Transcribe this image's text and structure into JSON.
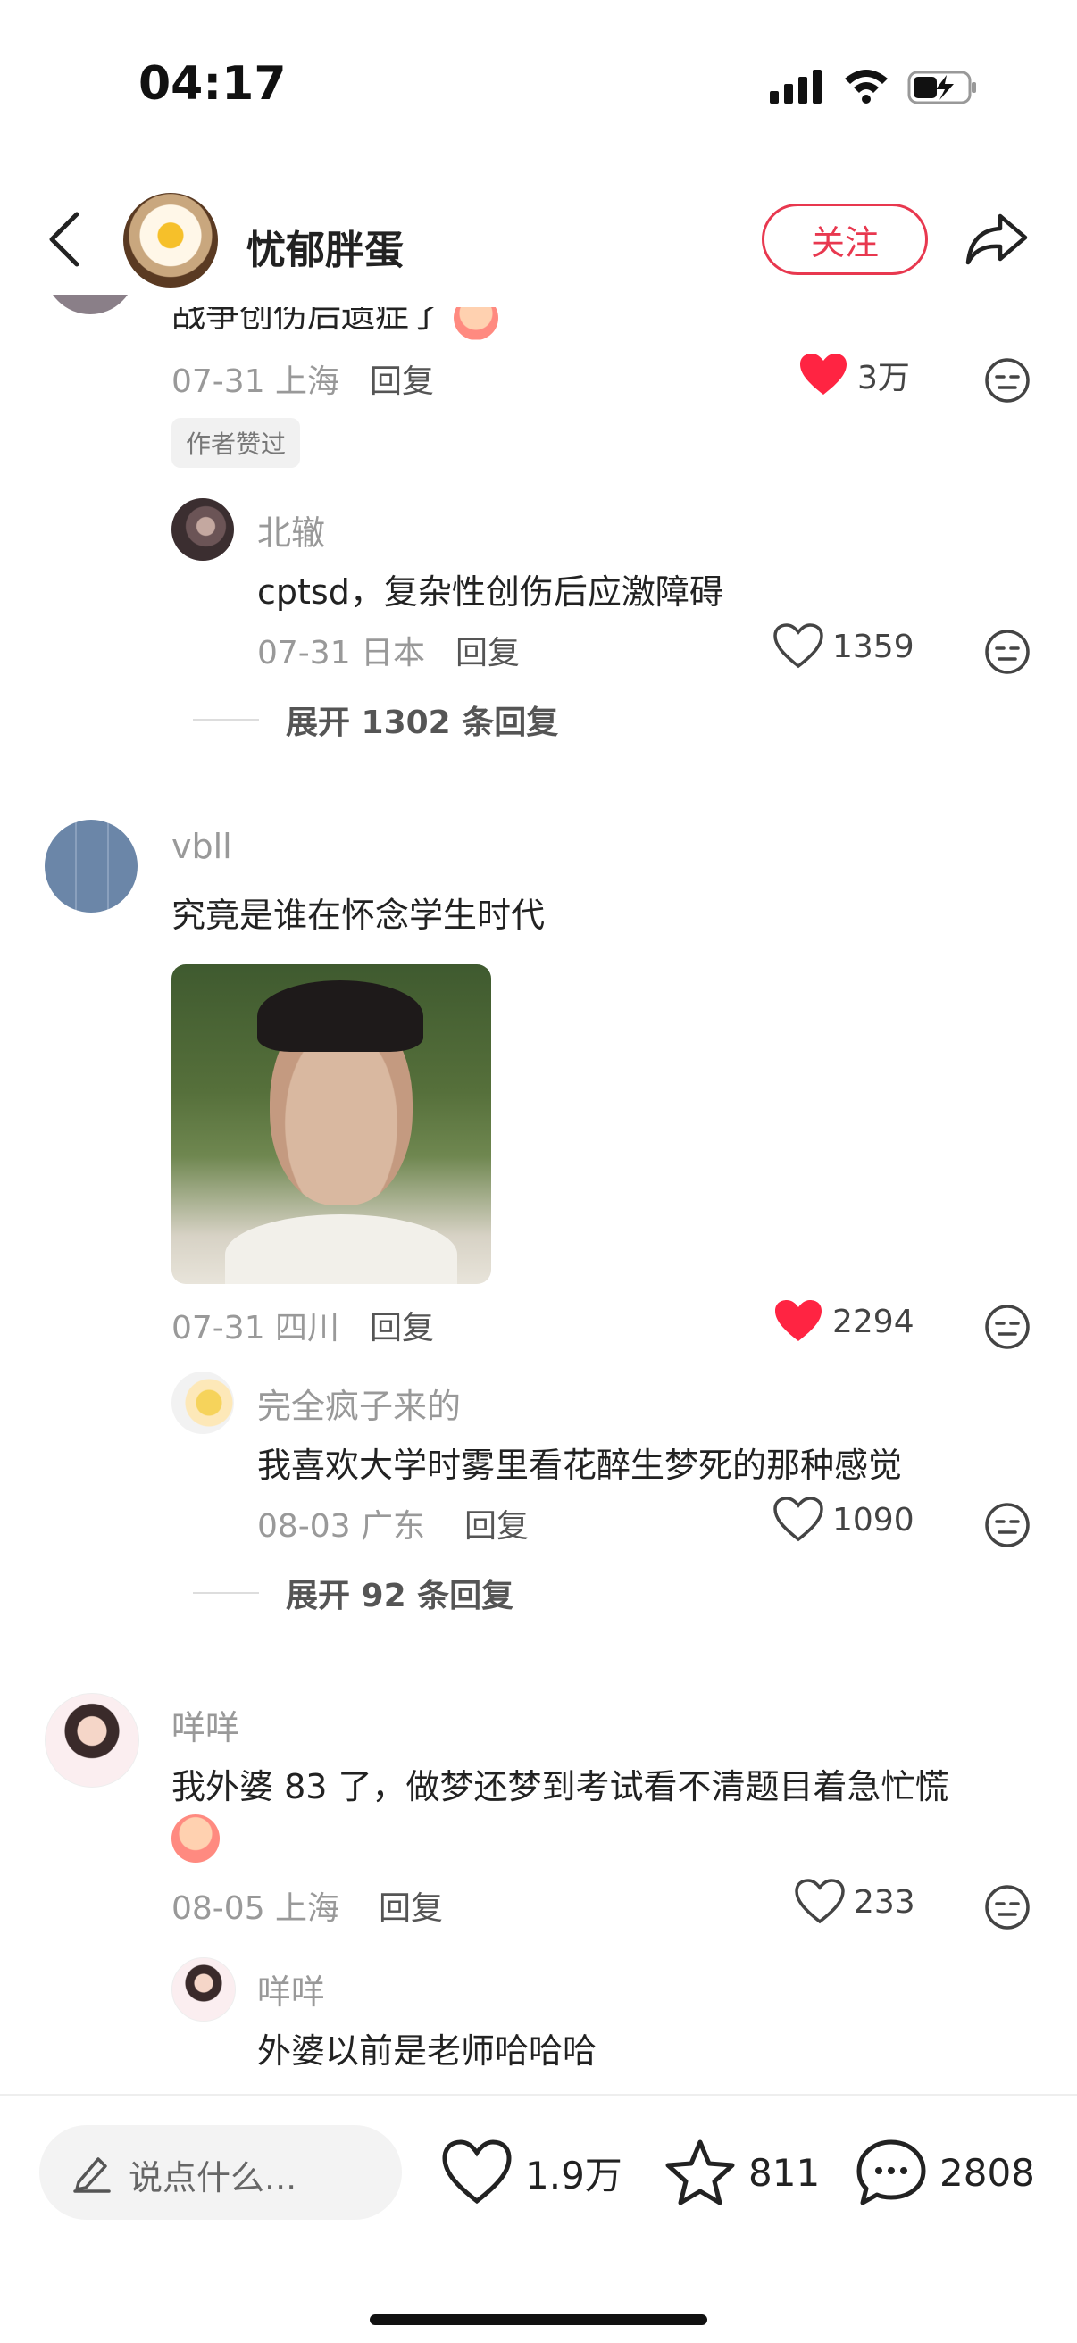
{
  "status": {
    "time": "04:17"
  },
  "header": {
    "author": "忧郁胖蛋",
    "follow_label": "关注"
  },
  "comments": [
    {
      "text_partial": "战争创伤后遗症了",
      "date": "07-31 上海",
      "reply_label": "回复",
      "likes": "3万",
      "liked": true,
      "badge": "作者赞过",
      "sub": {
        "user": "北辙",
        "text": "cptsd，复杂性创伤后应激障碍",
        "date": "07-31 日本",
        "reply_label": "回复",
        "likes": "1359"
      },
      "expand_label": "展开 1302 条回复"
    },
    {
      "user": "vbll",
      "text": "究竟是谁在怀念学生时代",
      "date": "07-31 四川",
      "reply_label": "回复",
      "likes": "2294",
      "liked": true,
      "sub": {
        "user": "完全疯子来的",
        "text": "我喜欢大学时雾里看花醉生梦死的那种感觉",
        "date": "08-03 广东",
        "reply_label": "回复",
        "likes": "1090"
      },
      "expand_label": "展开 92 条回复"
    },
    {
      "user": "咩咩",
      "text": "我外婆 83 了，做梦还梦到考试看不清题目着急忙慌",
      "date": "08-05 上海",
      "reply_label": "回复",
      "likes": "233",
      "liked": false,
      "sub": {
        "user": "咩咩",
        "text": "外婆以前是老师哈哈哈"
      }
    }
  ],
  "bottom": {
    "placeholder": "说点什么...",
    "likes": "1.9万",
    "stars": "811",
    "comments": "2808"
  },
  "colors": {
    "accent": "#e8384f",
    "liked": "#ff2442",
    "muted": "#999999"
  }
}
